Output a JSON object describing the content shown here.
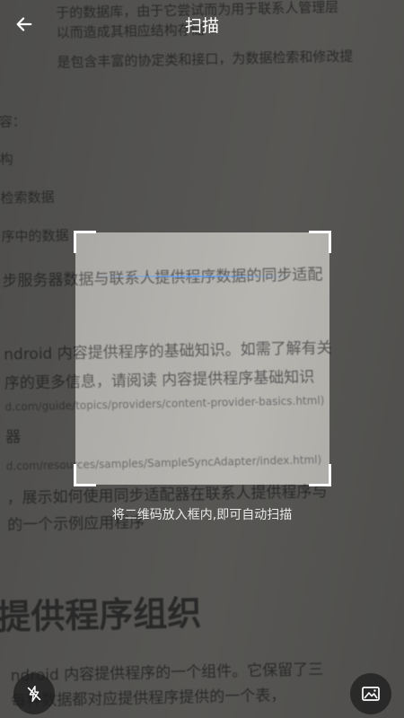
{
  "header": {
    "title": "扫描",
    "back_icon": "arrow-left-icon"
  },
  "scanner": {
    "hint": "将二维码放入框内,即可自动扫描"
  },
  "controls": {
    "flash_icon": "flash-off-icon",
    "gallery_icon": "gallery-image-icon"
  },
  "background_document": {
    "lines": [
      "于的数据库，由于它尝试而为用于联系人管理层",
      "以而造成其相应结构存储",
      "是包含丰富的协定类和接口，为数据检索和修改提",
      "容：",
      "构",
      "检索数据",
      "序中的数据",
      "步服务器数据与联系人提供程序数据的同步适配",
      "ndroid 内容提供程序的基础知识。如需了解有关",
      "序的更多信息，请阅读 内容提供程序基础知识",
      "d.com/guide/topics/providers/content-provider-basics.html)",
      "器",
      "d.com/resources/samples/SampleSyncAdapter/index.html)",
      "，展示如何使用同步适配器在联系人提供程序与",
      "的一个示例应用程序",
      "提供程序组织",
      "ndroid 内容提供程序的一个组件。它保留了三",
      "每种数据都对应提供程序提供的一个表，"
    ]
  }
}
